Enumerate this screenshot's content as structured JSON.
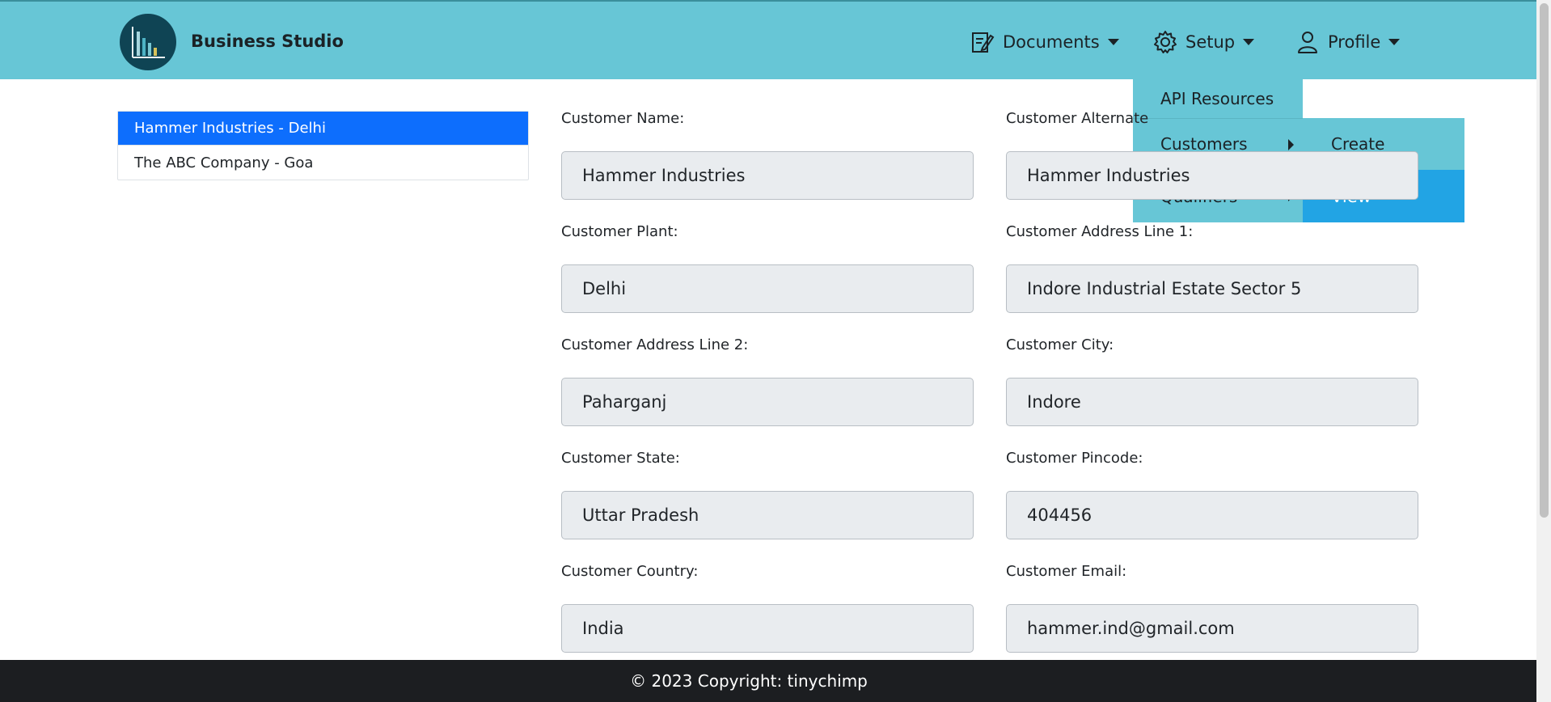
{
  "brand": {
    "name": "Business Studio",
    "logo_icon": "bar-chart-logo-icon"
  },
  "nav": {
    "documents": {
      "label": "Documents",
      "icon": "document-edit-icon"
    },
    "setup": {
      "label": "Setup",
      "icon": "gear-icon"
    },
    "profile": {
      "label": "Profile",
      "icon": "user-icon"
    }
  },
  "setup_menu": {
    "api_resources": "API Resources",
    "customers": "Customers",
    "qualifiers": "Qualifiers"
  },
  "customers_submenu": {
    "create": "Create",
    "view": "View"
  },
  "customer_list": [
    {
      "label": "Hammer Industries - Delhi",
      "active": true
    },
    {
      "label": "The ABC Company - Goa",
      "active": false
    }
  ],
  "form": {
    "name": {
      "label": "Customer Name:",
      "value": "Hammer Industries"
    },
    "alternate": {
      "label": "Customer Alternate",
      "value": "Hammer Industries"
    },
    "plant": {
      "label": "Customer Plant:",
      "value": "Delhi"
    },
    "address1": {
      "label": "Customer Address Line 1:",
      "value": "Indore Industrial Estate Sector 5"
    },
    "address2": {
      "label": "Customer Address Line 2:",
      "value": "Paharganj"
    },
    "city": {
      "label": "Customer City:",
      "value": "Indore"
    },
    "state": {
      "label": "Customer State:",
      "value": "Uttar Pradesh"
    },
    "pincode": {
      "label": "Customer Pincode:",
      "value": "404456"
    },
    "country": {
      "label": "Customer Country:",
      "value": "India"
    },
    "email": {
      "label": "Customer Email:",
      "value": "hammer.ind@gmail.com"
    }
  },
  "footer": {
    "copyright": "© 2023 Copyright: tinychimp"
  },
  "colors": {
    "navbar": "#67c6d6",
    "active_item": "#0d6efd",
    "submenu_highlight": "#22a4e4",
    "footer": "#1c1e21"
  }
}
